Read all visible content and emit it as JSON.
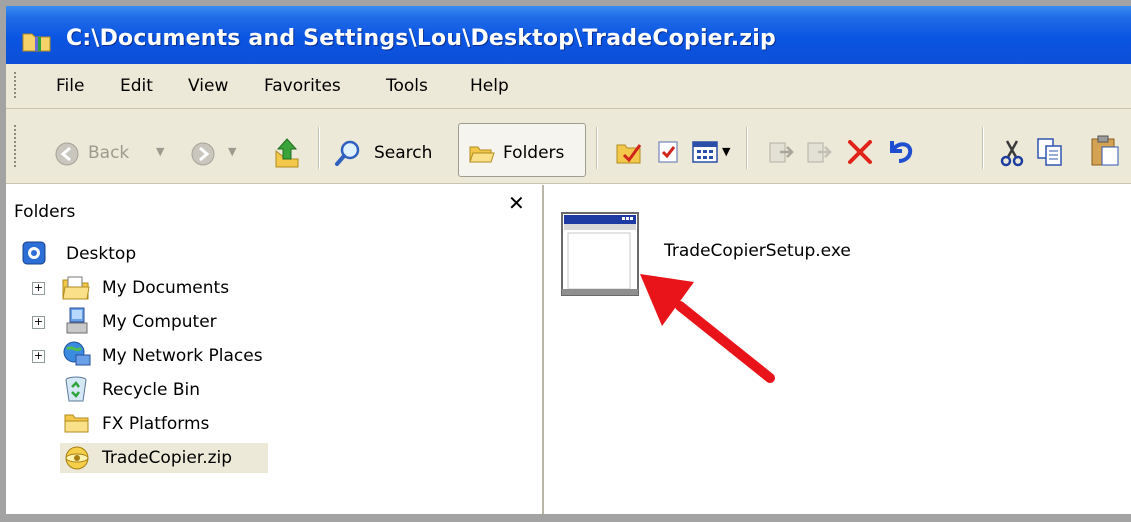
{
  "window": {
    "title": "C:\\Documents and Settings\\Lou\\Desktop\\TradeCopier.zip",
    "title_icon": "zip-folder-icon"
  },
  "menu": {
    "items": [
      "File",
      "Edit",
      "View",
      "Favorites",
      "Tools",
      "Help"
    ]
  },
  "toolbar": {
    "back_label": "Back",
    "search_label": "Search",
    "folders_label": "Folders"
  },
  "folders_pane": {
    "title": "Folders",
    "close_glyph": "✕",
    "tree": [
      {
        "label": "Desktop",
        "icon": "desktop-icon"
      },
      {
        "label": "My Documents",
        "icon": "my-documents-icon",
        "expandable": true
      },
      {
        "label": "My Computer",
        "icon": "my-computer-icon",
        "expandable": true
      },
      {
        "label": "My Network Places",
        "icon": "network-places-icon",
        "expandable": true
      },
      {
        "label": "Recycle Bin",
        "icon": "recycle-bin-icon"
      },
      {
        "label": "FX Platforms",
        "icon": "folder-icon"
      },
      {
        "label": "TradeCopier.zip",
        "icon": "zip-folder-icon",
        "selected": true
      }
    ]
  },
  "content": {
    "file": {
      "name": "TradeCopierSetup.exe",
      "icon": "application-icon"
    },
    "annotation": {
      "color": "#e8141a"
    }
  },
  "colors": {
    "titlebar": "#0a55e3",
    "chrome": "#ece9d8",
    "selection": "#ece9d8"
  }
}
